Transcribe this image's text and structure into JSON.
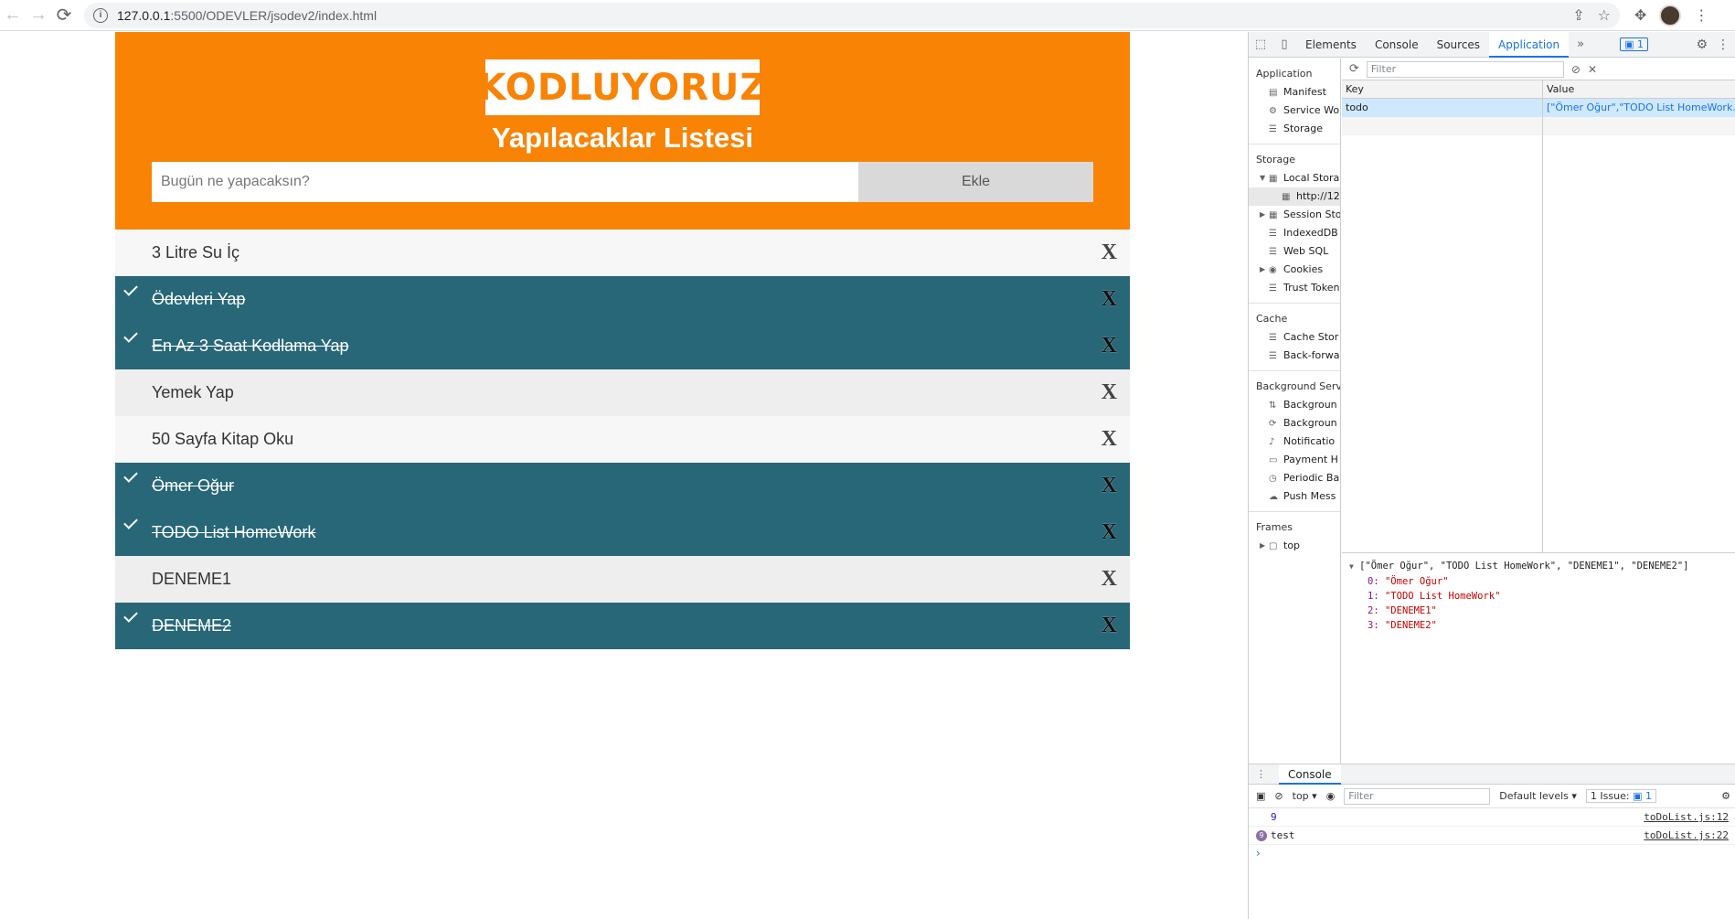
{
  "browser": {
    "url_host": "127.0.0.1",
    "url_path": ":5500/ODEVLER/jsodev2/index.html"
  },
  "app": {
    "logo": "KODLUYORUZ",
    "title": "Yapılacaklar Listesi",
    "input_placeholder": "Bugün ne yapacaksın?",
    "add_label": "Ekle",
    "close_label": "X",
    "items": [
      {
        "text": "3 Litre Su İç",
        "checked": false
      },
      {
        "text": "Ödevleri Yap",
        "checked": true
      },
      {
        "text": "En Az 3 Saat Kodlama Yap",
        "checked": true
      },
      {
        "text": "Yemek Yap",
        "checked": false
      },
      {
        "text": "50 Sayfa Kitap Oku",
        "checked": false
      },
      {
        "text": "Ömer Oğur",
        "checked": true
      },
      {
        "text": "TODO List HomeWork",
        "checked": true
      },
      {
        "text": "DENEME1",
        "checked": false
      },
      {
        "text": "DENEME2",
        "checked": true
      }
    ]
  },
  "devtools": {
    "tabs": [
      "Elements",
      "Console",
      "Sources",
      "Application"
    ],
    "issues_badge": "1",
    "sidebar": {
      "application_title": "Application",
      "application_items": [
        "Manifest",
        "Service Wo",
        "Storage"
      ],
      "storage_title": "Storage",
      "storage_items": [
        "Local Stora",
        "http://12",
        "Session Sto",
        "IndexedDB",
        "Web SQL",
        "Cookies",
        "Trust Token"
      ],
      "cache_title": "Cache",
      "cache_items": [
        "Cache Stor",
        "Back-forwa"
      ],
      "bg_title": "Background Servi",
      "bg_items": [
        "Backgroun",
        "Backgroun",
        "Notificatio",
        "Payment H",
        "Periodic Ba",
        "Push Mess"
      ],
      "frames_title": "Frames",
      "frames_items": [
        "top"
      ]
    },
    "filter_placeholder": "Filter",
    "grid": {
      "key_header": "Key",
      "value_header": "Value",
      "row_key": "todo",
      "row_value": "[\"Ömer Oğur\",\"TODO List HomeWork..."
    },
    "preview": {
      "summary": "[\"Ömer Oğur\", \"TODO List HomeWork\", \"DENEME1\", \"DENEME2\"]",
      "entries": [
        {
          "idx": "0:",
          "val": "\"Ömer Oğur\""
        },
        {
          "idx": "1:",
          "val": "\"TODO List HomeWork\""
        },
        {
          "idx": "2:",
          "val": "\"DENEME1\""
        },
        {
          "idx": "3:",
          "val": "\"DENEME2\""
        }
      ]
    },
    "console": {
      "tab_label": "Console",
      "context": "top",
      "filter_placeholder": "Filter",
      "levels": "Default levels",
      "issues": "1 Issue:",
      "issues_count": "1",
      "lines": [
        {
          "msg": "9",
          "src": "toDoList.js:12",
          "badge": ""
        },
        {
          "msg": "test",
          "src": "toDoList.js:22",
          "badge": "9"
        }
      ],
      "prompt": "›"
    }
  }
}
